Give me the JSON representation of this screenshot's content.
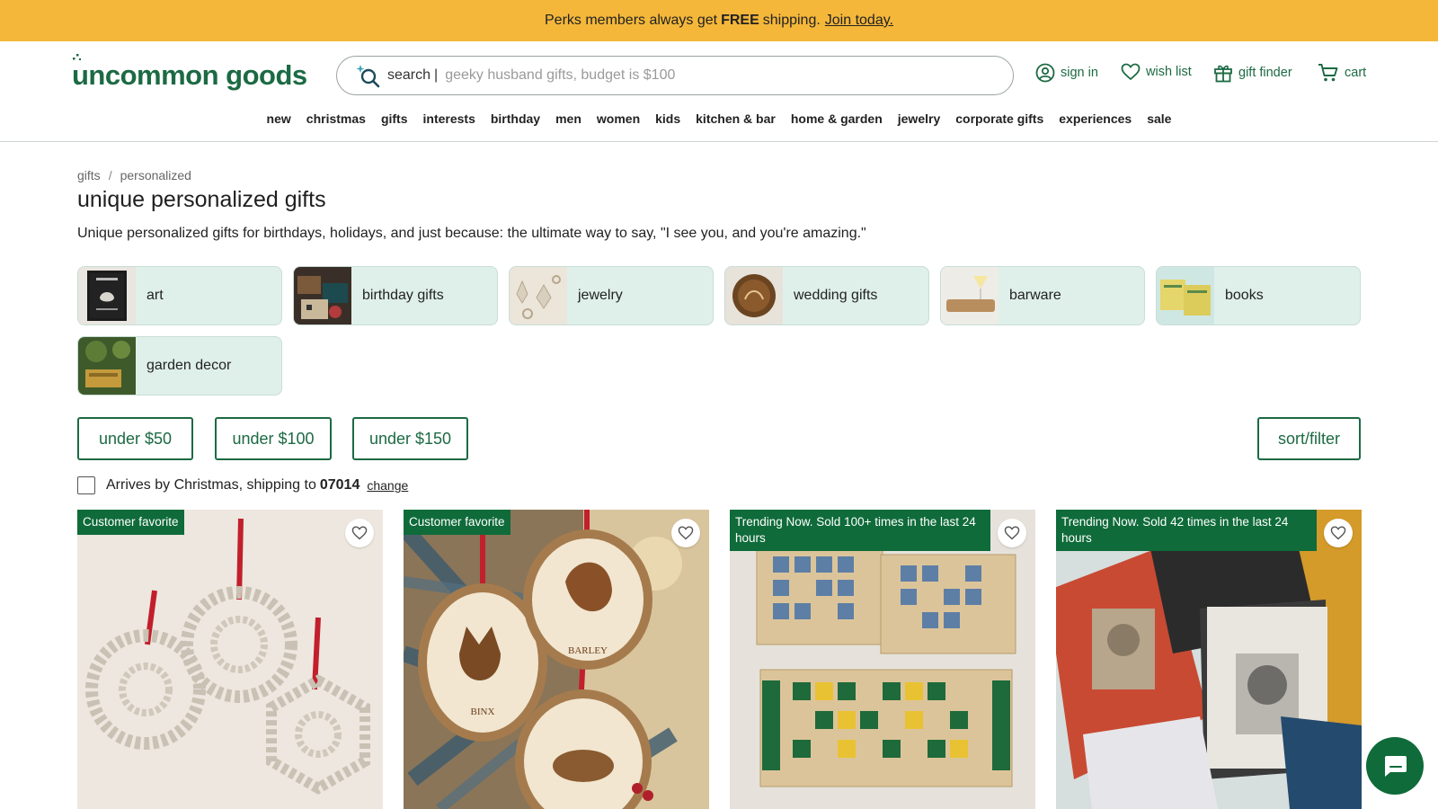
{
  "promo": {
    "pre": "Perks members always get",
    "bold": "FREE",
    "post": "shipping.",
    "link": "Join today."
  },
  "header": {
    "logo": "uncommon goods",
    "search_label": "search",
    "search_sep": "|",
    "search_placeholder": "geeky husband gifts, budget is $100",
    "util": {
      "sign_in": "sign in",
      "wish_list": "wish list",
      "gift_finder": "gift finder",
      "cart": "cart"
    }
  },
  "nav": [
    "new",
    "christmas",
    "gifts",
    "interests",
    "birthday",
    "men",
    "women",
    "kids",
    "kitchen & bar",
    "home & garden",
    "jewelry",
    "corporate gifts",
    "experiences",
    "sale"
  ],
  "breadcrumb": [
    "gifts",
    "personalized"
  ],
  "page_title": "unique personalized gifts",
  "description": "Unique personalized gifts for birthdays, holidays, and just because: the ultimate way to say, \"I see you, and you're amazing.\"",
  "categories": [
    "art",
    "birthday gifts",
    "jewelry",
    "wedding gifts",
    "barware",
    "books",
    "garden decor"
  ],
  "price_filters": [
    "under $50",
    "under $100",
    "under $150"
  ],
  "sort_filter": "sort/filter",
  "arrives": {
    "text": "Arrives by Christmas, shipping to",
    "zip": "07014",
    "change": "change"
  },
  "products": [
    {
      "badge": "Customer favorite"
    },
    {
      "badge": "Customer favorite"
    },
    {
      "badge": "Trending Now. Sold 100+ times in the last 24 hours"
    },
    {
      "badge": "Trending Now. Sold 42 times in the last 24 hours"
    }
  ],
  "colors": {
    "promo_bg": "#f4b73a",
    "brand_green": "#1c6a43",
    "badge_green": "#0f6b3a",
    "chip_bg": "#dff0eb"
  }
}
